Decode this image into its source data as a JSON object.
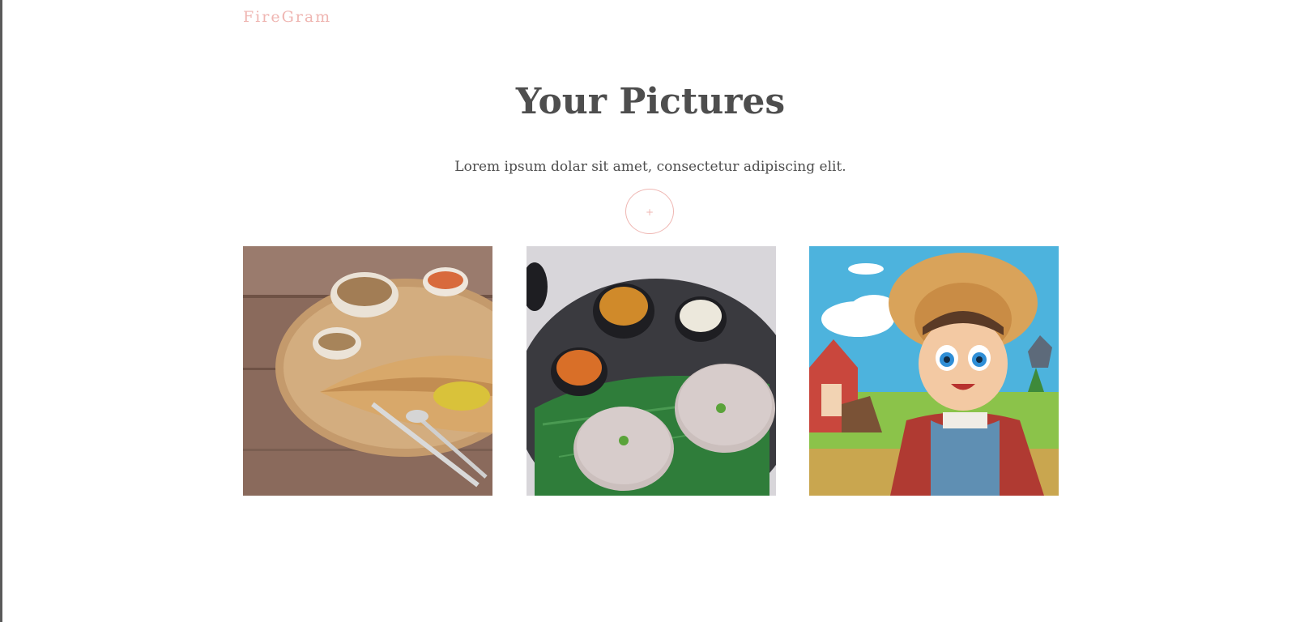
{
  "header": {
    "logo": "FireGram"
  },
  "main": {
    "title": "Your Pictures",
    "subtitle": "Lorem ipsum dolar sit amet, consectetur adipiscing elit.",
    "upload_label": "+"
  },
  "gallery": {
    "images": [
      {
        "subject": "dosa-with-sambar-and-chutney"
      },
      {
        "subject": "idli-plate-with-sambar-and-chutney"
      },
      {
        "subject": "cartoon-farmer-boy"
      }
    ]
  },
  "colors": {
    "accent": "#efb6b2",
    "text": "#4e4e4e",
    "background": "#ffffff"
  }
}
